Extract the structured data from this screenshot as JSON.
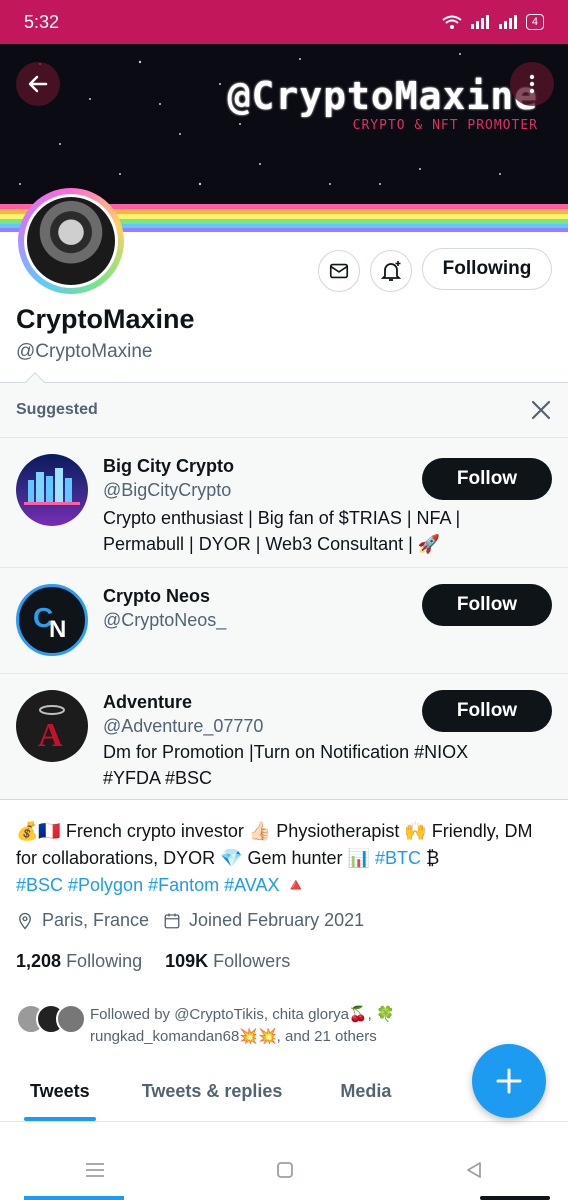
{
  "status_bar": {
    "time": "5:32",
    "battery": "4"
  },
  "banner": {
    "title": "@CryptoMaxine",
    "subtitle": "CRYPTO & NFT PROMOTER"
  },
  "profile": {
    "name": "CryptoMaxine",
    "handle": "@CryptoMaxine",
    "following_label": "Following"
  },
  "suggested": {
    "title": "Suggested",
    "items": [
      {
        "name": "Big City Crypto",
        "handle": "@BigCityCrypto",
        "bio": "Crypto enthusiast | Big fan of $TRIAS | NFA | Permabull | DYOR | Web3 Consultant | 🚀",
        "button": "Follow"
      },
      {
        "name": "Crypto Neos",
        "handle": "@CryptoNeos_",
        "bio": "",
        "button": "Follow"
      },
      {
        "name": "Adventure",
        "handle": "@Adventure_07770",
        "bio": "Dm for Promotion |Turn on Notification #NIOX #YFDA #BSC",
        "button": "Follow"
      }
    ]
  },
  "bio": {
    "line1": "💰🇫🇷 French crypto investor 👍🏻 Physiotherapist 🙌 Friendly, DM for collaborations, DYOR 💎 Gem hunter 📊 ",
    "tag_btc": "#BTC",
    "btc_emoji": " ₿",
    "tags_rest": "#BSC #Polygon #Fantom #AVAX",
    "tail_emoji": " 🔺"
  },
  "meta": {
    "location": "Paris, France",
    "joined": "Joined February 2021"
  },
  "counts": {
    "following_num": "1,208",
    "following_label": "Following",
    "followers_num": "109K",
    "followers_label": "Followers"
  },
  "followed_by": "Followed by @CryptoTikis, chita glorya🍒, 🍀 rungkad_komandan68💥💥, and 21 others",
  "tabs": [
    "Tweets",
    "Tweets & replies",
    "Media"
  ],
  "colors": {
    "accent": "#1d9bf0",
    "status_bar": "#c2185b"
  }
}
